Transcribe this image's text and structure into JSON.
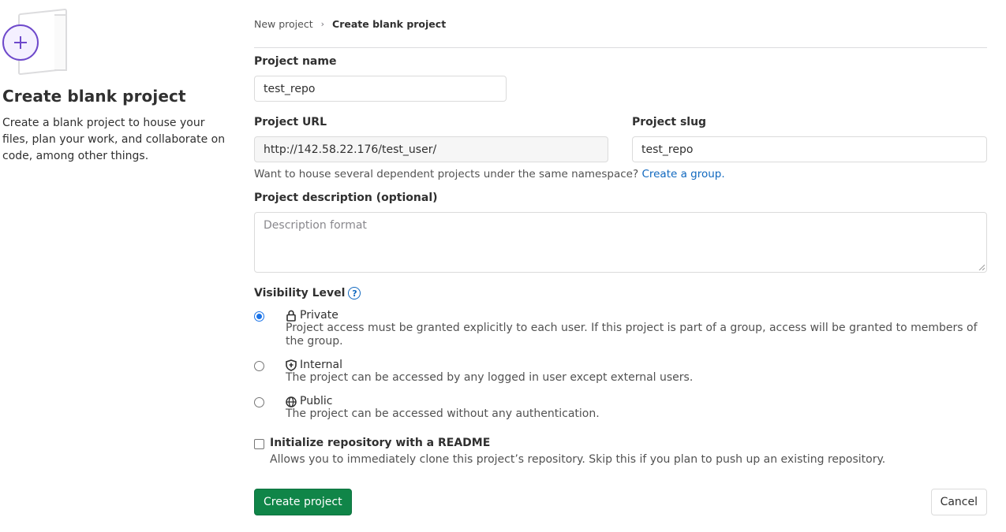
{
  "left": {
    "heading": "Create blank project",
    "description": "Create a blank project to house your files, plan your work, and collaborate on code, among other things.",
    "illustration_icon": "plus-circle-icon"
  },
  "breadcrumb": {
    "parent": "New project",
    "separator": "›",
    "current": "Create blank project"
  },
  "form": {
    "project_name_label": "Project name",
    "project_name_value": "test_repo",
    "project_url_label": "Project URL",
    "project_url_value": "http://142.58.22.176/test_user/",
    "project_slug_label": "Project slug",
    "project_slug_value": "test_repo",
    "namespace_help": "Want to house several dependent projects under the same namespace?",
    "create_group_link": "Create a group.",
    "description_label": "Project description (optional)",
    "description_placeholder": "Description format",
    "visibility_label": "Visibility Level",
    "visibility_help_icon": "question-circle-icon",
    "visibility_options": [
      {
        "name": "Private",
        "icon": "lock-icon",
        "description": "Project access must be granted explicitly to each user. If this project is part of a group, access will be granted to members of the group.",
        "selected": true
      },
      {
        "name": "Internal",
        "icon": "shield-icon",
        "description": "The project can be accessed by any logged in user except external users.",
        "selected": false
      },
      {
        "name": "Public",
        "icon": "globe-icon",
        "description": "The project can be accessed without any authentication.",
        "selected": false
      }
    ],
    "readme_label": "Initialize repository with a README",
    "readme_help": "Allows you to immediately clone this project’s repository. Skip this if you plan to push up an existing repository.",
    "readme_checked": false
  },
  "actions": {
    "create_label": "Create project",
    "cancel_label": "Cancel"
  },
  "colors": {
    "primary_button": "#108548",
    "link": "#1068bf",
    "illustration_accent": "#6e49cb"
  }
}
